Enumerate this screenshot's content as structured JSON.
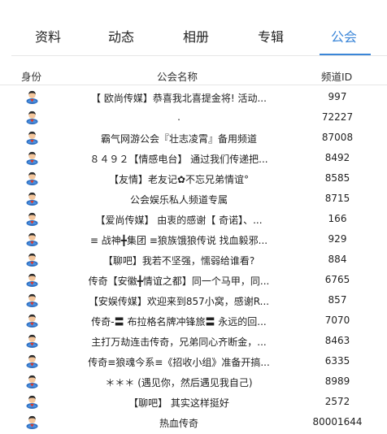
{
  "tabs": [
    {
      "label": "资料",
      "active": false
    },
    {
      "label": "动态",
      "active": false
    },
    {
      "label": "相册",
      "active": false
    },
    {
      "label": "专辑",
      "active": false
    },
    {
      "label": "公会",
      "active": true
    }
  ],
  "colors": {
    "accent": "#3b86d8",
    "divider": "#e6e6e6"
  },
  "table": {
    "headers": {
      "identity": "身份",
      "name": "公会名称",
      "channel_id": "频道ID"
    },
    "identity_icon": "member-avatar-icon",
    "rows": [
      {
        "name": "【 欧尚传媒】恭喜我北喜提金将! 活动...",
        "channel_id": "997"
      },
      {
        "name": ".",
        "channel_id": "72227"
      },
      {
        "name": "霸气网游公会『壮志凌霄』备用频道",
        "channel_id": "87008"
      },
      {
        "name": "８４９２【情感电台】 通过我们传递把...",
        "channel_id": "8492"
      },
      {
        "name": "【友情】老友记✿不忘兄弟情谊°",
        "channel_id": "8585"
      },
      {
        "name": "公会娱乐私人频道专属",
        "channel_id": "8715"
      },
      {
        "name": "【爱尚传媒】 由衷的感谢【 奇诺】、...",
        "channel_id": "166"
      },
      {
        "name": "≡ 战神╋集团 ≡狼族饿狼传说  找血毅邪...",
        "channel_id": "929"
      },
      {
        "name": "【聊吧】我若不坚强，懦弱给谁看?",
        "channel_id": "884"
      },
      {
        "name": "传奇【安徽╋情谊之都】同一个马甲，同...",
        "channel_id": "6765"
      },
      {
        "name": "【安娱传媒】欢迎来到857小窝，感谢R...",
        "channel_id": "857"
      },
      {
        "name": "传奇-〓 布拉格名牌冲锋旅〓 永远的回...",
        "channel_id": "7070"
      },
      {
        "name": "主打万劫连击传奇，兄弟同心齐断金，...",
        "channel_id": "8463"
      },
      {
        "name": "传奇≡狼魂今系≡《招收小组》准备开搞...",
        "channel_id": "6335"
      },
      {
        "name": "＊＊＊ (遇见你，然后遇见我自己)",
        "channel_id": "8989"
      },
      {
        "name": "【聊吧】 其实这样挺好",
        "channel_id": "2572"
      },
      {
        "name": "热血传奇",
        "channel_id": "80001644"
      }
    ]
  }
}
